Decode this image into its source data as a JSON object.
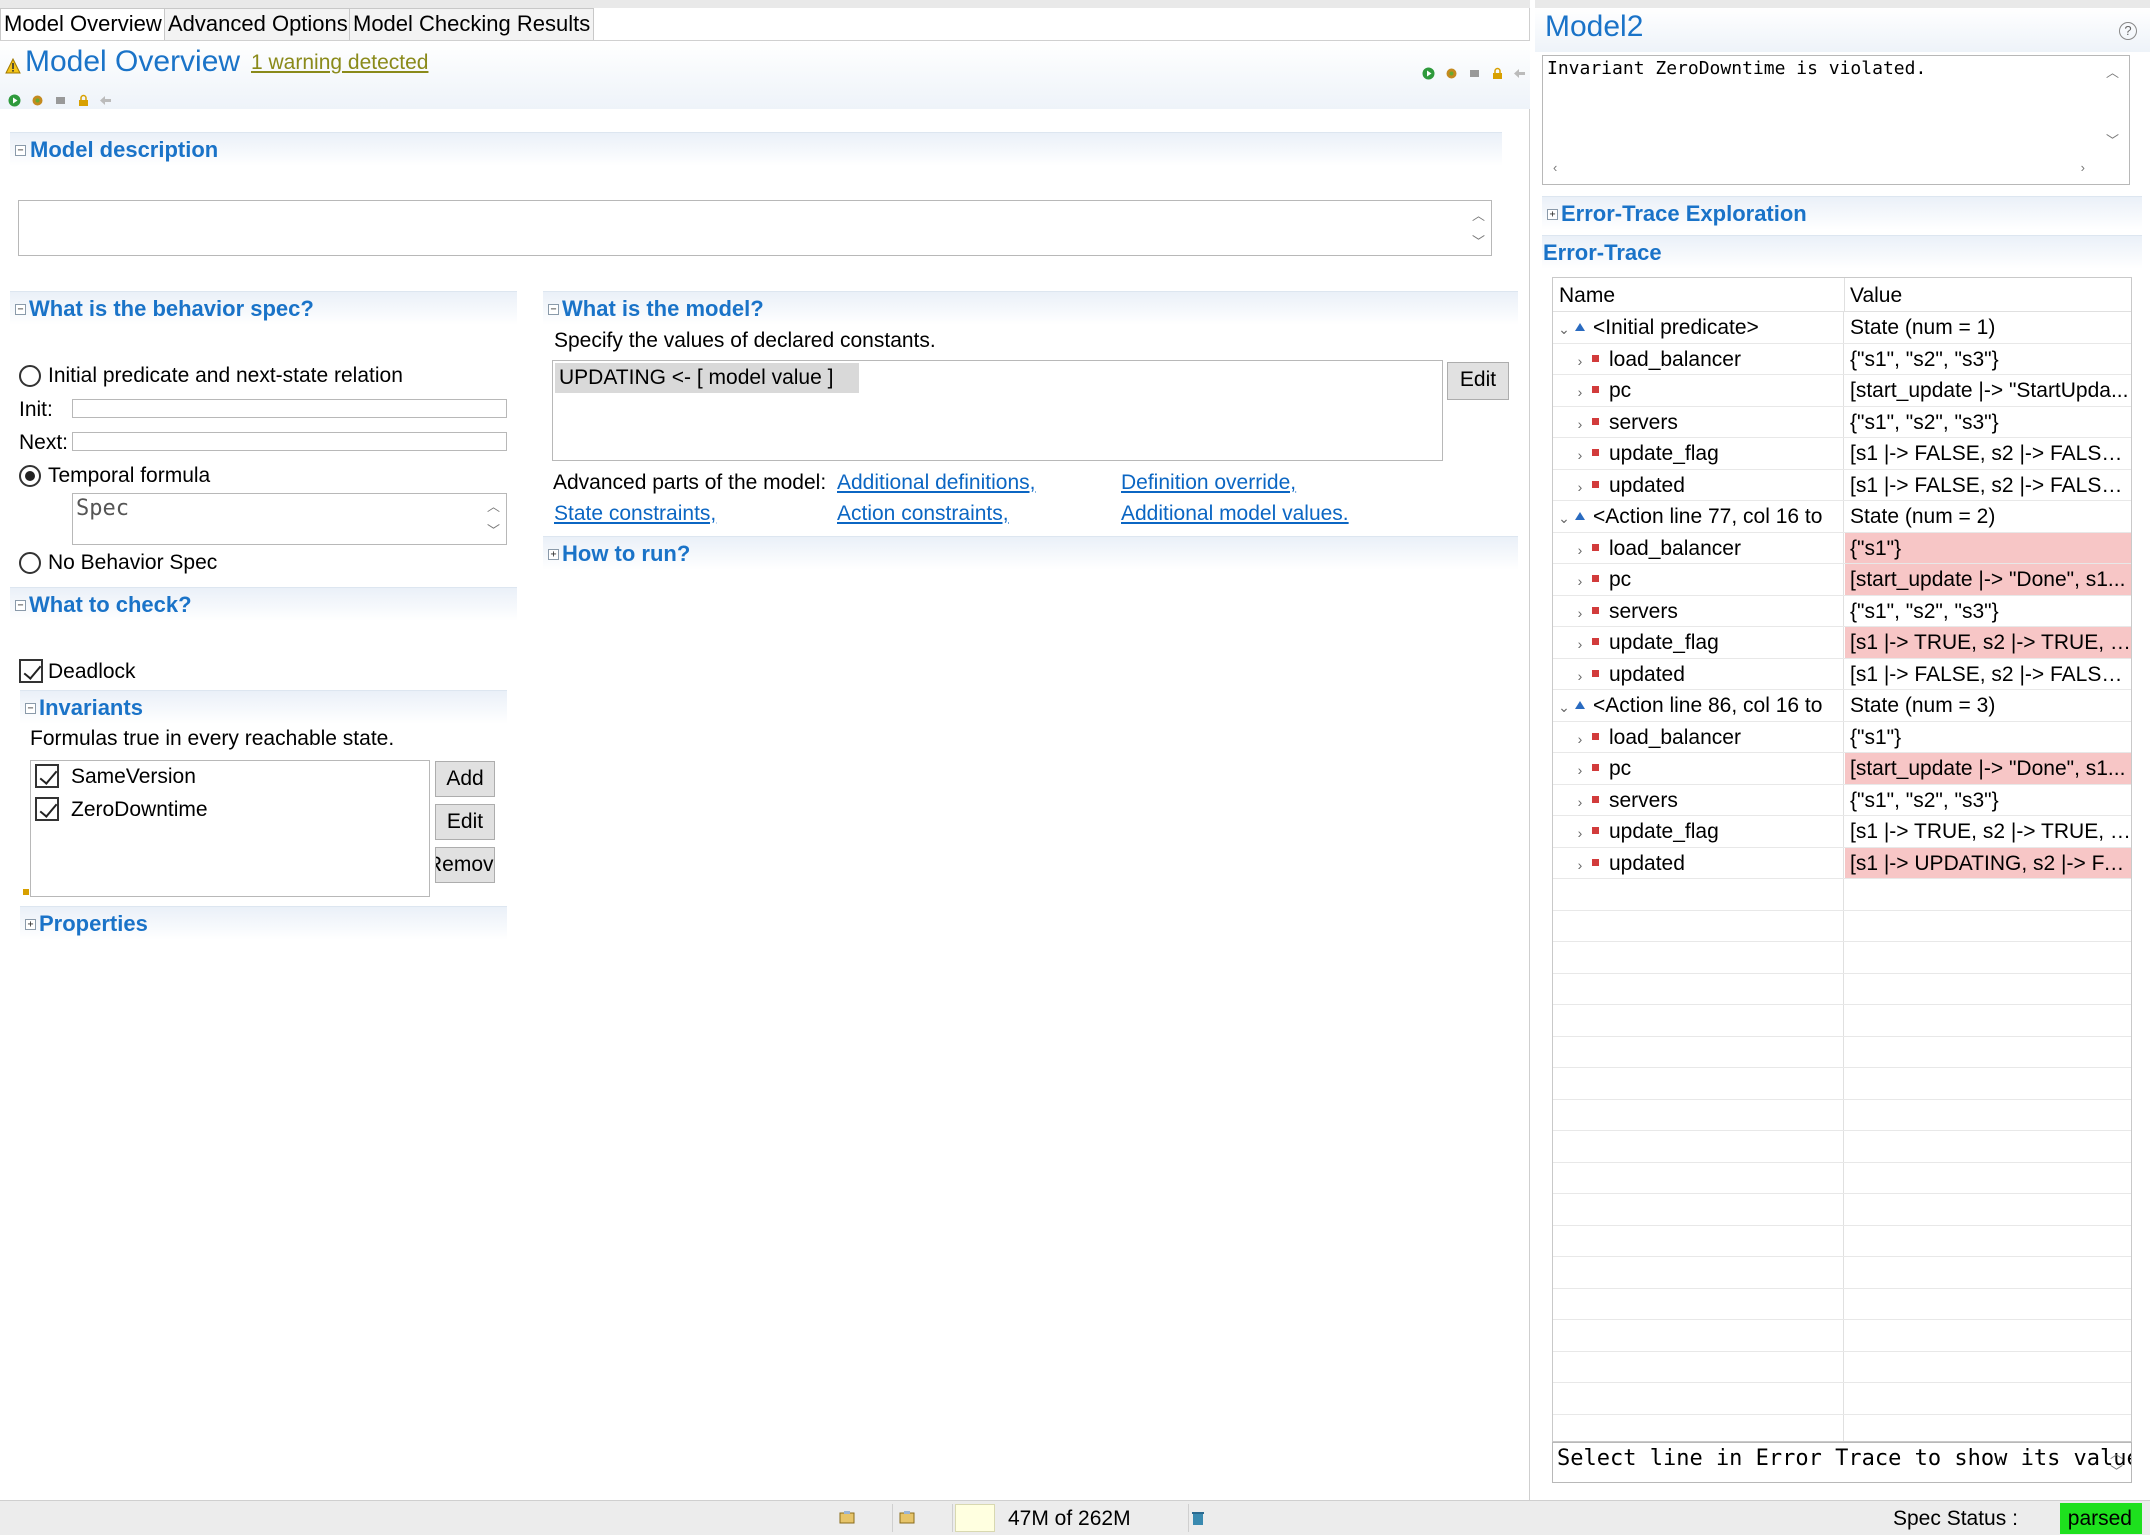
{
  "editor_tabs": [
    {
      "label": "Model Overview",
      "active": true
    },
    {
      "label": "Advanced Options",
      "active": false
    },
    {
      "label": "Model Checking Results",
      "active": false
    }
  ],
  "header": {
    "title": "Model Overview",
    "warning_link": "1 warning detected"
  },
  "model_description": {
    "title": "Model description",
    "value": ""
  },
  "behavior": {
    "title": "What is the behavior spec?",
    "option_init_next": "Initial predicate and next-state relation",
    "init_label": "Init:",
    "next_label": "Next:",
    "option_temporal": "Temporal formula",
    "temporal_value": "Spec",
    "option_none": "No Behavior Spec",
    "selected": "temporal"
  },
  "check": {
    "title": "What to check?",
    "deadlock_label": "Deadlock",
    "invariants_title": "Invariants",
    "invariants_desc": "Formulas true in every reachable state.",
    "invariants": [
      "SameVersion",
      "ZeroDowntime"
    ],
    "add_label": "Add",
    "edit_label": "Edit",
    "remove_label": "Remove",
    "properties_title": "Properties"
  },
  "model": {
    "title": "What is the model?",
    "desc": "Specify the values of declared constants.",
    "constants": [
      "UPDATING <-  [ model value ]"
    ],
    "edit_label": "Edit",
    "advanced_label": "Advanced parts of the model:",
    "links": [
      "Additional definitions,",
      "Definition override,",
      "State constraints,",
      "Action constraints,",
      "Additional model values."
    ],
    "how_to_run": "How to run?"
  },
  "results": {
    "title": "Model2",
    "help_icon": "?",
    "message": "Invariant ZeroDowntime is violated.",
    "exploration_title": "Error-Trace Exploration",
    "trace_title": "Error-Trace",
    "col_name": "Name",
    "col_value": "Value",
    "rows": [
      {
        "kind": "state",
        "name": "<Initial predicate>",
        "value": "State (num = 1)",
        "changed": false
      },
      {
        "kind": "var",
        "name": "load_balancer",
        "value": "{\"s1\", \"s2\", \"s3\"}",
        "changed": false
      },
      {
        "kind": "var",
        "name": "pc",
        "value": "[start_update |-> \"StartUpda...",
        "changed": false
      },
      {
        "kind": "var",
        "name": "servers",
        "value": "{\"s1\", \"s2\", \"s3\"}",
        "changed": false
      },
      {
        "kind": "var",
        "name": "update_flag",
        "value": "[s1 |-> FALSE, s2 |-> FALSE, ...",
        "changed": false
      },
      {
        "kind": "var",
        "name": "updated",
        "value": "[s1 |-> FALSE, s2 |-> FALSE, ...",
        "changed": false
      },
      {
        "kind": "state",
        "name": "<Action line 77, col 16 to",
        "value": "State (num = 2)",
        "changed": false
      },
      {
        "kind": "var",
        "name": "load_balancer",
        "value": "{\"s1\"}",
        "changed": true
      },
      {
        "kind": "var",
        "name": "pc",
        "value": "[start_update |-> \"Done\", s1...",
        "changed": true
      },
      {
        "kind": "var",
        "name": "servers",
        "value": "{\"s1\", \"s2\", \"s3\"}",
        "changed": false
      },
      {
        "kind": "var",
        "name": "update_flag",
        "value": "[s1 |-> TRUE, s2 |-> TRUE, s...",
        "changed": true
      },
      {
        "kind": "var",
        "name": "updated",
        "value": "[s1 |-> FALSE, s2 |-> FALSE, ...",
        "changed": false
      },
      {
        "kind": "state",
        "name": "<Action line 86, col 16 to",
        "value": "State (num = 3)",
        "changed": false
      },
      {
        "kind": "var",
        "name": "load_balancer",
        "value": "{\"s1\"}",
        "changed": false
      },
      {
        "kind": "var",
        "name": "pc",
        "value": "[start_update |-> \"Done\", s1...",
        "changed": true
      },
      {
        "kind": "var",
        "name": "servers",
        "value": "{\"s1\", \"s2\", \"s3\"}",
        "changed": false
      },
      {
        "kind": "var",
        "name": "update_flag",
        "value": "[s1 |-> TRUE, s2 |-> TRUE, s...",
        "changed": false
      },
      {
        "kind": "var",
        "name": "updated",
        "value": "[s1 |-> UPDATING, s2 |-> FA...",
        "changed": true
      }
    ],
    "detail_placeholder": "Select line in Error Trace to show its value here."
  },
  "status": {
    "memory": "47M of 262M",
    "spec_status_label": "Spec Status :",
    "spec_status_value": "parsed"
  },
  "colors": {
    "accent": "#1a73c8",
    "changed_row": "#f7c6c6",
    "parsed": "#1ee01e",
    "warning_link": "#8a8a1a"
  }
}
